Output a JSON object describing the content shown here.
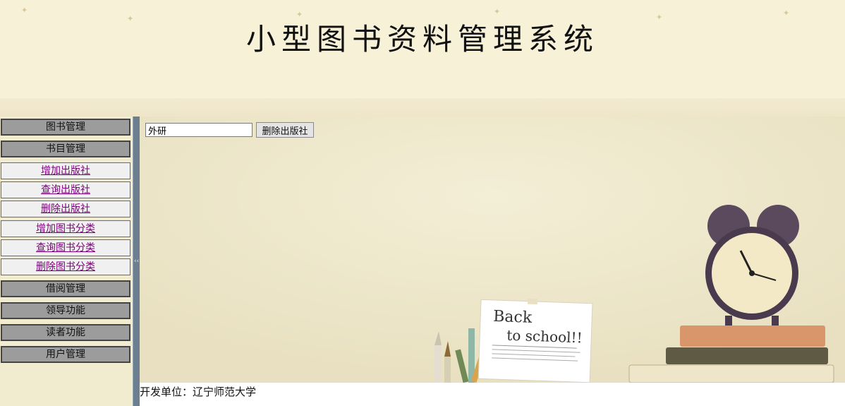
{
  "header": {
    "title": "小型图书资料管理系统"
  },
  "sidebar": {
    "sections": [
      {
        "label": "图书管理"
      },
      {
        "label": "书目管理"
      }
    ],
    "sub_items": [
      {
        "label": "增加出版社"
      },
      {
        "label": "查询出版社"
      },
      {
        "label": "删除出版社"
      },
      {
        "label": "增加图书分类"
      },
      {
        "label": "查询图书分类"
      },
      {
        "label": "删除图书分类"
      }
    ],
    "bottom_sections": [
      {
        "label": "借阅管理"
      },
      {
        "label": "领导功能"
      },
      {
        "label": "读者功能"
      },
      {
        "label": "用户管理"
      }
    ],
    "splitter_glyph": "‹‹"
  },
  "form": {
    "publisher_value": "外研",
    "delete_label": "删除出版社"
  },
  "footer": {
    "text": "开发单位：辽宁师范大学"
  }
}
